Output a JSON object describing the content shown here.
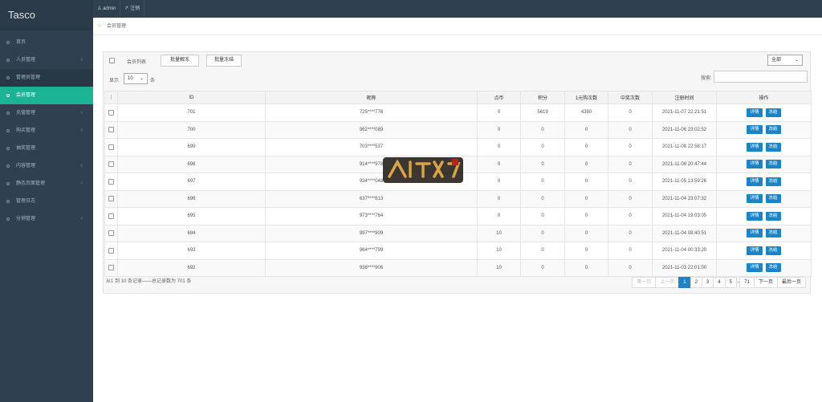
{
  "app": {
    "brand": "Tasco"
  },
  "topbar": {
    "user_label": "admin",
    "logout_label": "注销"
  },
  "sidebar": {
    "items": [
      {
        "label": "首页",
        "chevron": ""
      },
      {
        "label": "人员管理",
        "chevron": "‹"
      },
      {
        "label": "管理员管理",
        "chevron": ""
      },
      {
        "label": "会员管理",
        "chevron": ""
      },
      {
        "label": "充值管理",
        "chevron": "‹"
      },
      {
        "label": "购买管理",
        "chevron": "‹"
      },
      {
        "label": "抽奖管理",
        "chevron": ""
      },
      {
        "label": "内容管理",
        "chevron": "‹"
      },
      {
        "label": "静态页面管理",
        "chevron": "‹"
      },
      {
        "label": "管理日志",
        "chevron": ""
      },
      {
        "label": "分销管理",
        "chevron": "‹"
      }
    ]
  },
  "breadcrumb": {
    "current": "会员管理"
  },
  "toolbar": {
    "list_label": "会员列表",
    "batch_unfreeze": "批量解冻",
    "batch_freeze": "批量冻结",
    "filter_selected": "全部",
    "show_label": "显示",
    "page_size": "10",
    "entries_label": "条",
    "search_label": "搜索:"
  },
  "table": {
    "headers": [
      "ID",
      "昵称",
      "点币",
      "积分",
      "1元购次数",
      "中奖次数",
      "注册时间",
      "操作"
    ],
    "rows": [
      [
        "701",
        "725****778",
        "0",
        "5619",
        "4380",
        "0",
        "2021-11-07 22:21:51"
      ],
      [
        "700",
        "962****089",
        "0",
        "0",
        "0",
        "0",
        "2021-11-06 23:02:52"
      ],
      [
        "699",
        "703****537",
        "0",
        "0",
        "0",
        "0",
        "2021-11-08 22:58:17"
      ],
      [
        "698",
        "914****978",
        "0",
        "0",
        "0",
        "0",
        "2021-11-06 20:47:44"
      ],
      [
        "697",
        "934****048",
        "0",
        "0",
        "0",
        "0",
        "2021-11-05 13:59:26"
      ],
      [
        "696",
        "637****813",
        "0",
        "0",
        "0",
        "0",
        "2021-11-04 23:07:32"
      ],
      [
        "695",
        "973****764",
        "0",
        "0",
        "0",
        "0",
        "2021-11-04 19:03:05"
      ],
      [
        "694",
        "997****909",
        "10",
        "0",
        "0",
        "0",
        "2021-11-04 08:40:51"
      ],
      [
        "693",
        "964****799",
        "10",
        "0",
        "0",
        "0",
        "2021-11-04 00:33:20"
      ],
      [
        "692",
        "938****906",
        "10",
        "0",
        "0",
        "0",
        "2021-11-03 22:01:00"
      ]
    ],
    "detail_label": "详情",
    "freeze_label": "冻结"
  },
  "footer": {
    "info": "从1 到 10 条记录——总记录数为 701 条"
  },
  "pagination": {
    "first": "第一页",
    "prev": "上一页",
    "pages": [
      "1",
      "2",
      "3",
      "4",
      "5"
    ],
    "ellipsis": "..",
    "last_page": "71",
    "next": "下一页",
    "last": "最后一页"
  },
  "colors": {
    "sidebar": "#2f4050",
    "active": "#1ab394",
    "primary": "#1c84c6"
  }
}
